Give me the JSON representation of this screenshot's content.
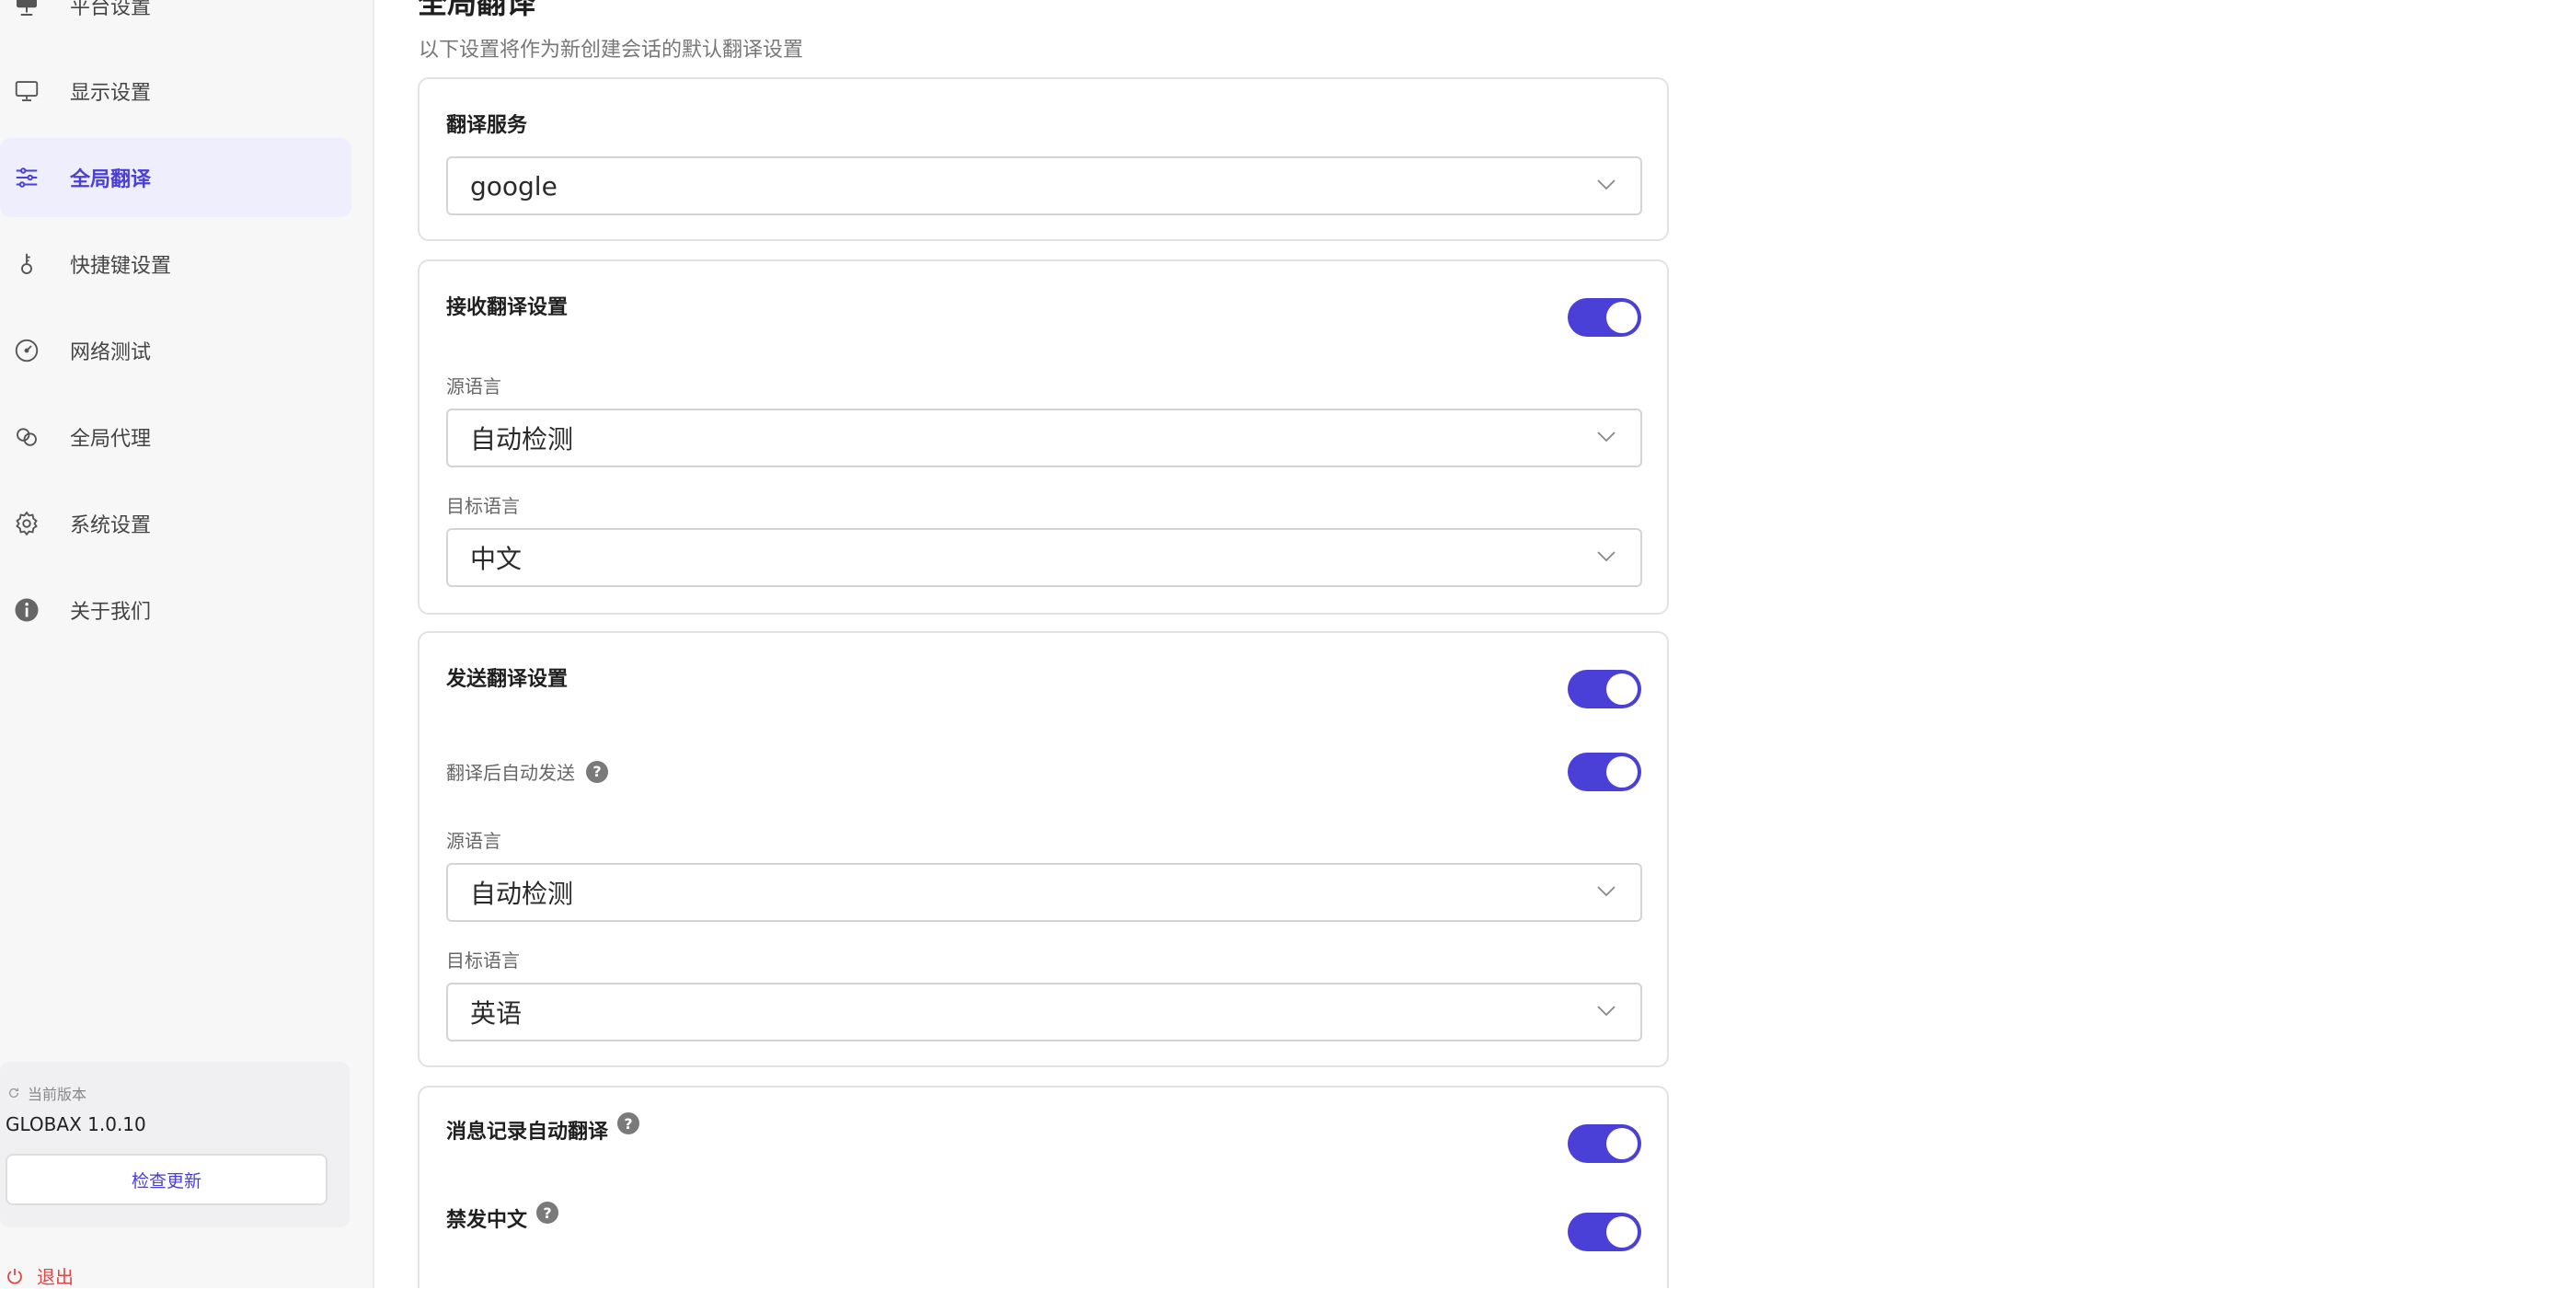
{
  "sidebar": {
    "items": [
      {
        "label": "平台设置",
        "icon": "monitor-stand-icon",
        "active": false
      },
      {
        "label": "显示设置",
        "icon": "monitor-icon",
        "active": false
      },
      {
        "label": "全局翻译",
        "icon": "sliders-icon",
        "active": true
      },
      {
        "label": "快捷键设置",
        "icon": "key-icon",
        "active": false
      },
      {
        "label": "网络测试",
        "icon": "speedometer-icon",
        "active": false
      },
      {
        "label": "全局代理",
        "icon": "link-icon",
        "active": false
      },
      {
        "label": "系统设置",
        "icon": "gear-icon",
        "active": false
      },
      {
        "label": "关于我们",
        "icon": "info-icon",
        "active": false
      }
    ],
    "version": {
      "caption": "当前版本",
      "value": "GLOBAX 1.0.10",
      "check_update_label": "检查更新"
    },
    "logout_label": "退出"
  },
  "main": {
    "title": "全局翻译",
    "subtitle": "以下设置将作为新创建会话的默认翻译设置",
    "service_card": {
      "title": "翻译服务",
      "select_value": "google"
    },
    "receive_card": {
      "title": "接收翻译设置",
      "enabled": true,
      "source_label": "源语言",
      "source_value": "自动检测",
      "target_label": "目标语言",
      "target_value": "中文"
    },
    "send_card": {
      "title": "发送翻译设置",
      "enabled": true,
      "auto_send_label": "翻译后自动发送",
      "auto_send_enabled": true,
      "source_label": "源语言",
      "source_value": "自动检测",
      "target_label": "目标语言",
      "target_value": "英语"
    },
    "misc_card": {
      "history_label": "消息记录自动翻译",
      "history_enabled": true,
      "ban_chinese_label": "禁发中文",
      "ban_chinese_enabled": true
    },
    "help_glyph": "?"
  },
  "colors": {
    "accent": "#4a3fd6",
    "danger": "#e04747",
    "active_bg": "#efeefc"
  }
}
